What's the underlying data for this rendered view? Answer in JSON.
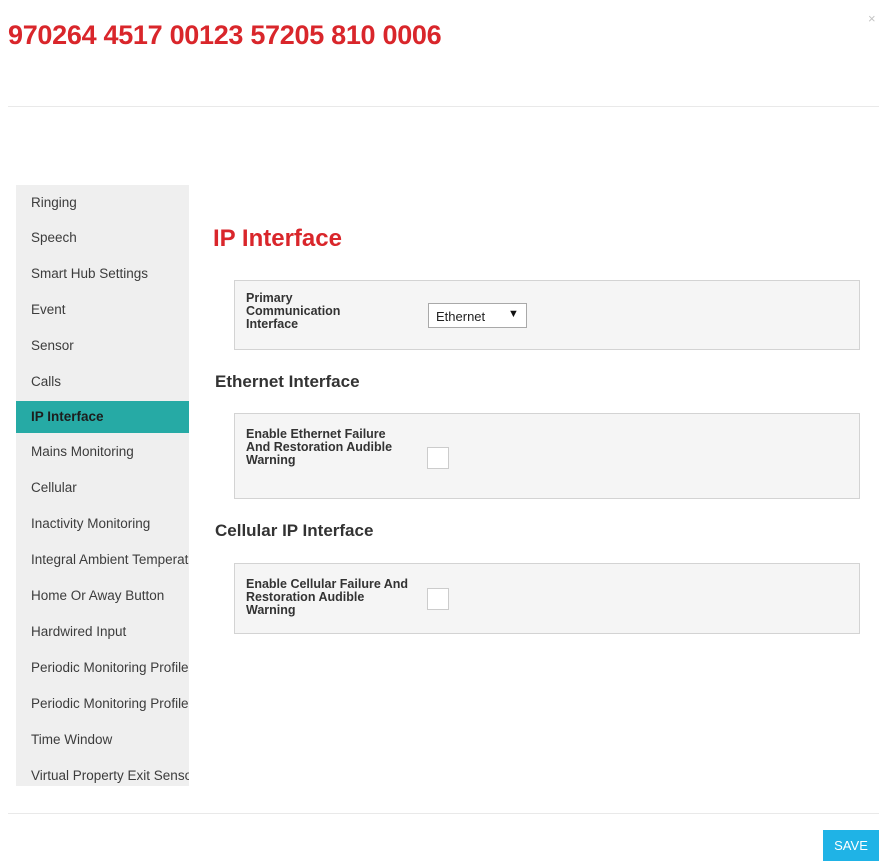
{
  "modal": {
    "title": "970264 4517 00123 57205 810 0006",
    "close_symbol": "×"
  },
  "sidebar": {
    "active_index": 6,
    "items": [
      {
        "label": "Ringing"
      },
      {
        "label": "Speech"
      },
      {
        "label": "Smart Hub Settings"
      },
      {
        "label": "Event"
      },
      {
        "label": "Sensor"
      },
      {
        "label": "Calls"
      },
      {
        "label": "IP Interface"
      },
      {
        "label": "Mains Monitoring"
      },
      {
        "label": "Cellular"
      },
      {
        "label": "Inactivity Monitoring"
      },
      {
        "label": "Integral Ambient Temperature"
      },
      {
        "label": "Home Or Away Button"
      },
      {
        "label": "Hardwired Input"
      },
      {
        "label": "Periodic Monitoring Profile"
      },
      {
        "label": "Periodic Monitoring Profile"
      },
      {
        "label": "Time Window"
      },
      {
        "label": "Virtual Property Exit Sensor"
      }
    ]
  },
  "main": {
    "title": "IP Interface",
    "primary": {
      "label": "Primary Communication Interface",
      "select_value": "Ethernet",
      "chevron": "▼"
    },
    "ethernet": {
      "heading": "Ethernet Interface",
      "checkbox_label": "Enable Ethernet Failure And Restoration Audible Warning",
      "checked": false
    },
    "cellular": {
      "heading": "Cellular IP Interface",
      "checkbox_label": "Enable Cellular Failure And Restoration Audible Warning",
      "checked": false
    }
  },
  "footer": {
    "save_label": "SAVE"
  },
  "colors": {
    "title_red": "#d9262b",
    "active_teal": "#26aaa5",
    "save_blue": "#1fb3e6"
  }
}
